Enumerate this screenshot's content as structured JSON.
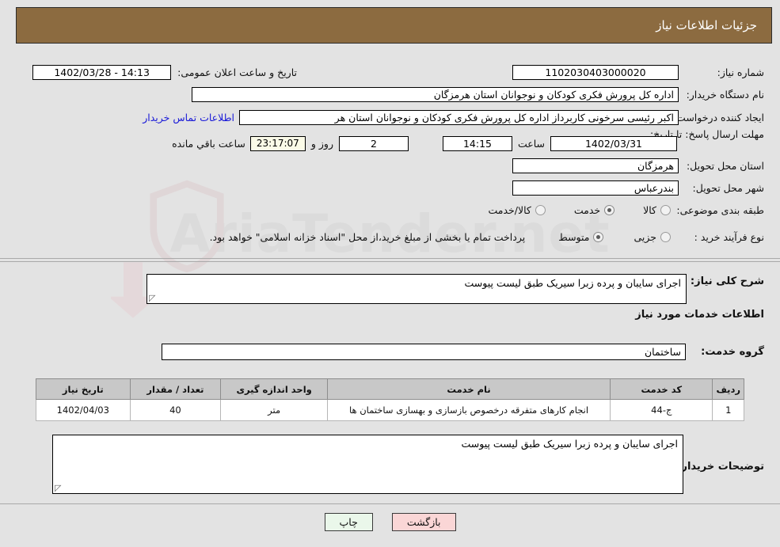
{
  "header": {
    "title": "جزئیات اطلاعات نیاز"
  },
  "watermark": {
    "text": "AriaTender.net"
  },
  "summary": {
    "need_number_label": "شماره نیاز:",
    "need_number_value": "1102030403000020",
    "announce_datetime_label": "تاریخ و ساعت اعلان عمومی:",
    "announce_datetime_value": "14:13 - 1402/03/28",
    "buyer_org_label": "نام دستگاه خریدار:",
    "buyer_org_value": "اداره کل پرورش فکری کودکان و نوجوانان استان هرمزگان",
    "requester_label": "ایجاد کننده درخواست:",
    "requester_value": "اکبر رئیسی سرخونی کاربرداز اداره کل پرورش فکری کودکان و نوجوانان استان هر",
    "contact_link": "اطلاعات تماس خریدار",
    "deadline_label": "مهلت ارسال پاسخ: تا تاریخ:",
    "deadline_date": "1402/03/31",
    "deadline_hour_label": "ساعت",
    "deadline_hour": "14:15",
    "remaining_days": "2",
    "remaining_days_label": "روز و",
    "remaining_time": "23:17:07",
    "remaining_time_label": "ساعت باقي مانده",
    "province_label": "استان محل تحویل:",
    "province_value": "هرمزگان",
    "city_label": "شهر محل تحویل:",
    "city_value": "بندرعباس",
    "category_label": "طبقه بندی موضوعی:",
    "category_options": [
      {
        "label": "کالا",
        "selected": false
      },
      {
        "label": "خدمت",
        "selected": true
      },
      {
        "label": "کالا/خدمت",
        "selected": false
      }
    ],
    "process_label": "نوع فرآیند خرید :",
    "process_options": [
      {
        "label": "جزیی",
        "selected": false
      },
      {
        "label": "متوسط",
        "selected": true
      }
    ],
    "payment_note": "پرداخت تمام یا بخشی از مبلغ خرید،از محل \"اسناد خزانه اسلامی\" خواهد بود."
  },
  "general": {
    "label": "شرح کلی نیاز:",
    "value": "اجرای سایبان و پرده زبرا سیریک طبق لیست پیوست"
  },
  "service": {
    "section_title": "اطلاعات خدمات مورد نیاز",
    "group_label": "گروه خدمت:",
    "group_value": "ساختمان"
  },
  "table": {
    "columns": [
      "ردیف",
      "کد خدمت",
      "نام خدمت",
      "واحد اندازه گیری",
      "تعداد / مقدار",
      "تاریخ نیاز"
    ],
    "rows": [
      {
        "index": "1",
        "code": "ج-44",
        "name": "انجام کارهای متفرقه درخصوص بازسازی و بهسازی ساختمان ها",
        "unit": "متر",
        "quantity": "40",
        "need_date": "1402/04/03"
      }
    ]
  },
  "buyer_notes": {
    "label": "توضیحات خریدار:",
    "value": "اجرای سایبان و پرده زبرا سیریک طبق لیست پیوست"
  },
  "buttons": {
    "print": "چاپ",
    "back": "بازگشت"
  },
  "colors": {
    "header_bg": "#8c6b40",
    "page_bg": "#e3e3e3",
    "link": "#1818d8",
    "print_btn": "#eaf7ea",
    "back_btn": "#fad6d6",
    "countdown_bg": "#fbfbe8"
  }
}
